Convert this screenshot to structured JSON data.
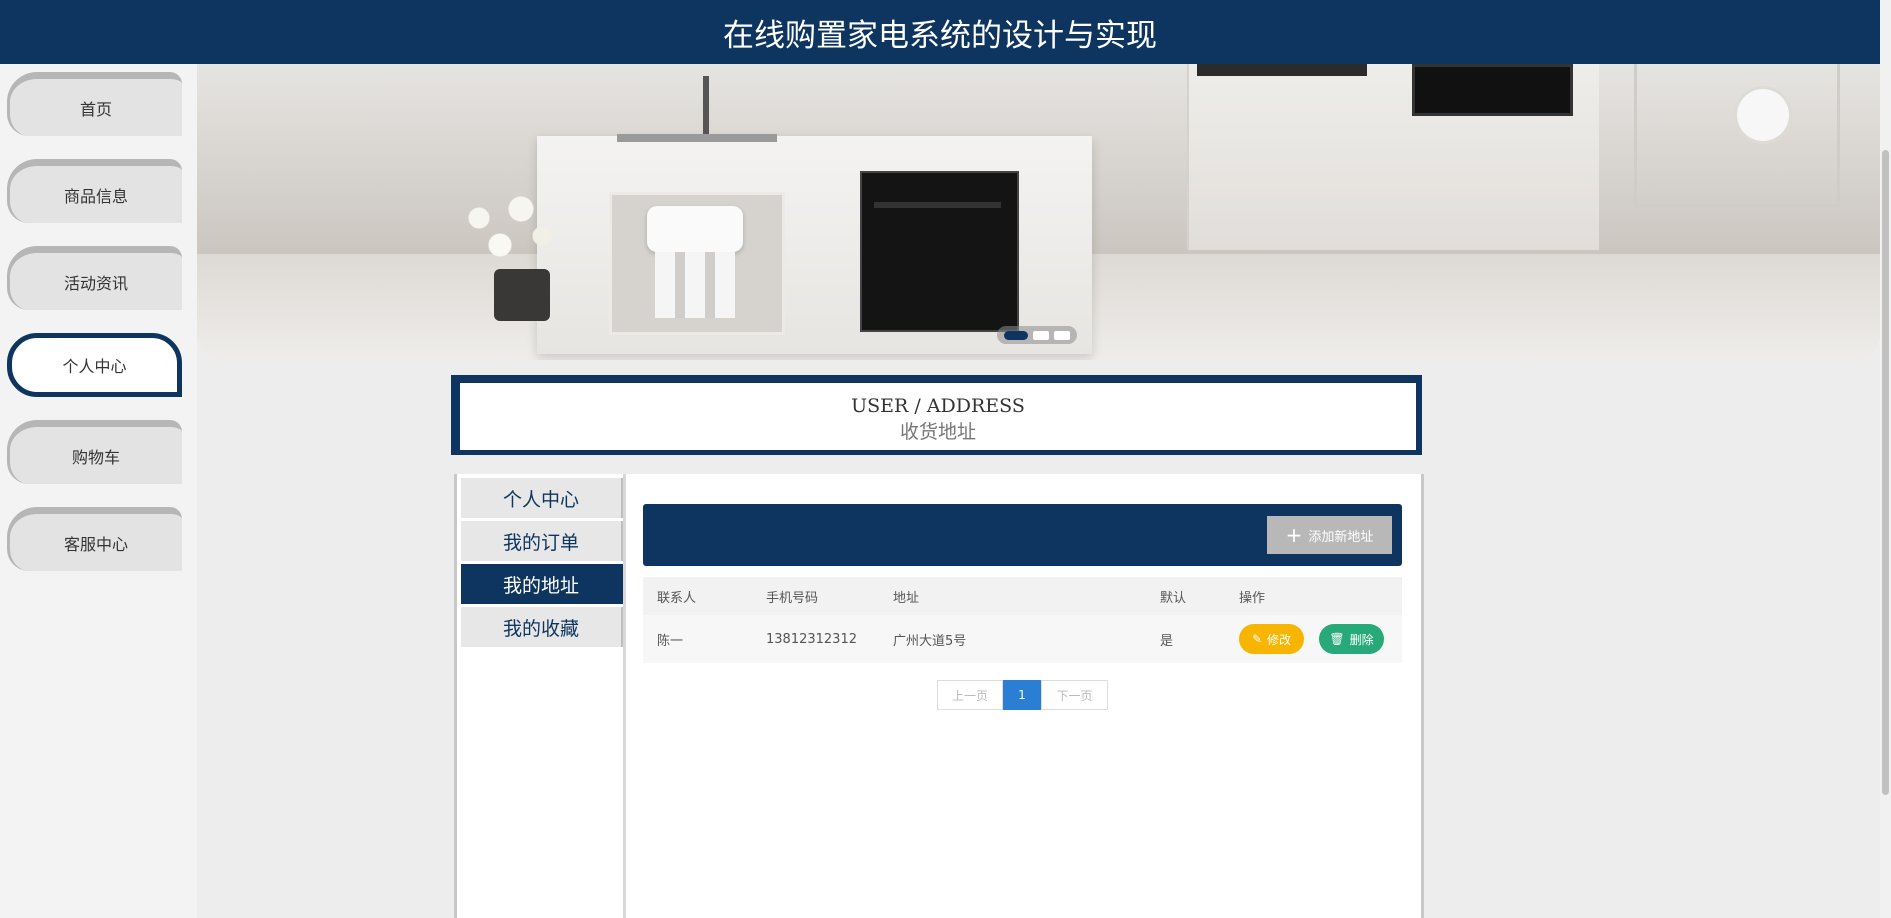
{
  "header": {
    "title": "在线购置家电系统的设计与实现"
  },
  "sidebar": {
    "items": [
      {
        "label": "首页",
        "active": false
      },
      {
        "label": "商品信息",
        "active": false
      },
      {
        "label": "活动资讯",
        "active": false
      },
      {
        "label": "个人中心",
        "active": true
      },
      {
        "label": "购物车",
        "active": false
      },
      {
        "label": "客服中心",
        "active": false
      }
    ]
  },
  "banner": {
    "slide_count": 3,
    "active_slide": 1
  },
  "section": {
    "title_en": "USER / ADDRESS",
    "title_cn": "收货地址"
  },
  "submenu": {
    "items": [
      {
        "label": "个人中心",
        "active": false
      },
      {
        "label": "我的订单",
        "active": false
      },
      {
        "label": "我的地址",
        "active": true
      },
      {
        "label": "我的收藏",
        "active": false
      }
    ]
  },
  "toolbar": {
    "add_label": "添加新地址"
  },
  "table": {
    "headers": [
      "联系人",
      "手机号码",
      "地址",
      "默认",
      "操作"
    ],
    "rows": [
      {
        "contact": "陈一",
        "phone": "13812312312",
        "address": "广州大道5号",
        "default": "是",
        "edit": "修改",
        "delete": "删除"
      }
    ]
  },
  "pager": {
    "prev": "上一页",
    "current": "1",
    "next": "下一页"
  },
  "colors": {
    "primary": "#0e355f",
    "edit": "#f7b500",
    "delete": "#27a97a",
    "page_active": "#2a7fd4"
  }
}
